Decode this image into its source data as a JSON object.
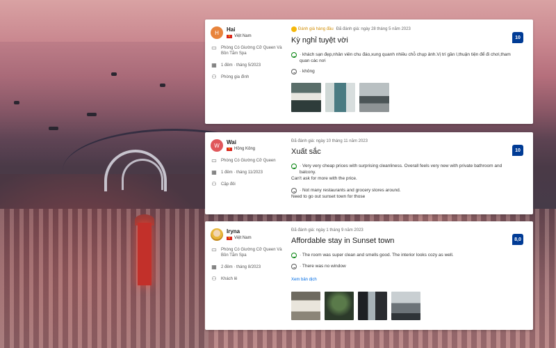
{
  "reviews": [
    {
      "initial": "H",
      "avatar_color": "#e8843c",
      "name": "Hai",
      "country": "Việt Nam",
      "room": "Phòng Có Giường Cỡ Queen Và Bồn Tắm Spa",
      "stay": "1 đêm · tháng 5/2023",
      "traveler": "Phòng gia đình",
      "top_badge": "Đánh giá hàng đầu",
      "date": "Đã đánh giá: ngày 28 tháng 5 năm 2023",
      "title": "Kỳ nghỉ tuyệt vời",
      "positive": "· khách sạn đẹp,nhân viên chu đáo,xung quanh nhiều chỗ chụp ảnh.Vị trí gần I,thuận tiện để đi chơi,tham quan các nơi",
      "negative": "· không",
      "score": "10"
    },
    {
      "initial": "W",
      "avatar_color": "#e0575b",
      "name": "Wai",
      "country": "Hồng Kông",
      "room": "Phòng Có Giường Cỡ Queen",
      "stay": "1 đêm · tháng 11/2023",
      "traveler": "Cặp đôi",
      "date": "Đã đánh giá: ngày 10 tháng 11 năm 2023",
      "title": "Xuất sắc",
      "positive_1": "· Very very cheap prices with surprising cleanliness. Overall feels very new with private bathroom and balcony.",
      "positive_2": "Can't ask for more with the price.",
      "negative_1": "· Not many restaurants and grocery stores around.",
      "negative_2": "Need to go out sunset town for those",
      "score": "10"
    },
    {
      "name": "Iryna",
      "country": "Việt Nam",
      "room": "Phòng Có Giường Cỡ Queen Và Bồn Tắm Spa",
      "stay": "2 đêm · tháng 8/2023",
      "traveler": "Khách lẻ",
      "date": "Đã đánh giá: ngày 1 tháng 9 năm 2023",
      "title": "Affordable stay in Sunset town",
      "positive": "· The room was super clean and smells good. The interior looks cozy as well.",
      "negative": "· There was no window",
      "translate": "Xem bản dịch",
      "score": "8,0"
    }
  ],
  "colors": {
    "score_bg": "#003b95",
    "link": "#006ce4",
    "positive": "#008009",
    "top_badge": "#d08c00"
  },
  "icons": {
    "room": "bed-icon",
    "stay": "calendar-icon",
    "traveler": "people-icon"
  }
}
